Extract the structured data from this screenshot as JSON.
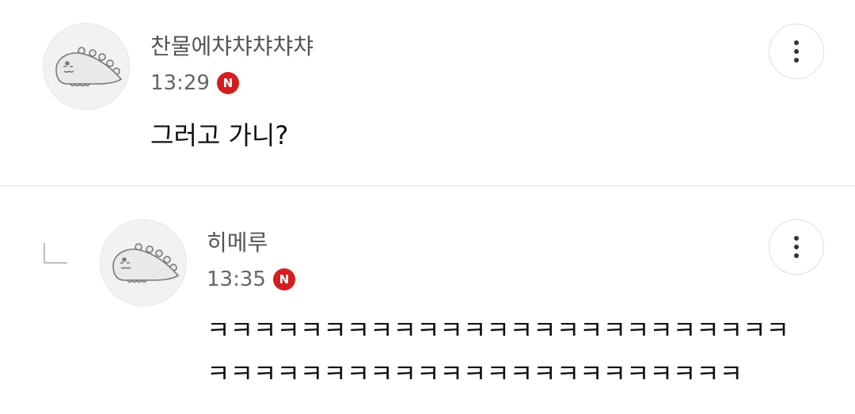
{
  "comments": [
    {
      "author": "찬물에챠챠챠챠챠",
      "time": "13:29",
      "new_badge": "N",
      "text": [
        "그러고 가니?"
      ],
      "avatar_icon": "dinosaur-avatar-icon",
      "is_reply": false
    },
    {
      "author": "히메루",
      "time": "13:35",
      "new_badge": "N",
      "text": [
        "ㅋㅋㅋㅋㅋㅋㅋㅋㅋㅋㅋㅋㅋㅋㅋㅋㅋㅋㅋㅋㅋㅋㅋㅋㅋ",
        "ㅋㅋㅋㅋㅋㅋㅋㅋㅋㅋㅋㅋㅋㅋㅋㅋㅋㅋㅋㅋㅋㅋㅋ"
      ],
      "avatar_icon": "dinosaur-avatar-icon",
      "is_reply": true
    }
  ],
  "colors": {
    "badge": "#d11f1f",
    "divider": "#e4e4e4",
    "author": "#555555",
    "text": "#111111"
  }
}
